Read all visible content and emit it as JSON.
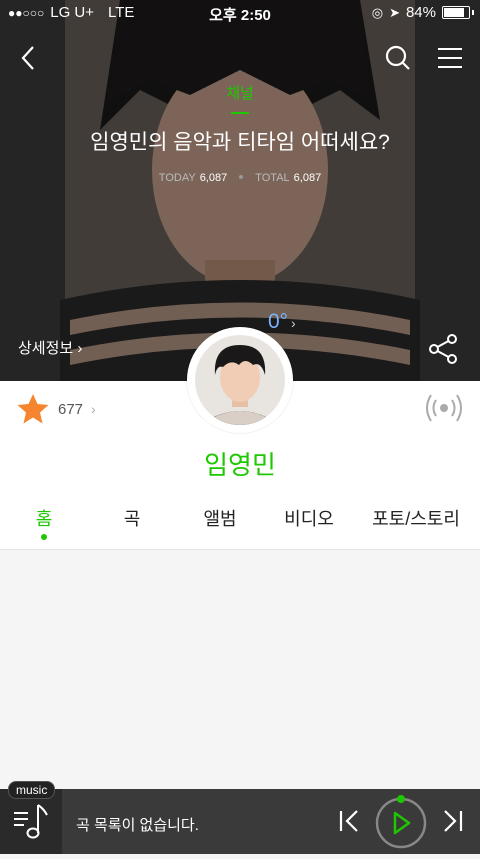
{
  "status_bar": {
    "carrier": "LG U+",
    "network": "LTE",
    "time": "오후 2:50",
    "battery": "84%",
    "battery_level": 0.84
  },
  "header": {
    "channel_label": "채널",
    "title": "임영민의 음악과 티타임 어떠세요?",
    "today_label": "TODAY",
    "today_count": "6,087",
    "total_label": "TOTAL",
    "total_count": "6,087",
    "degree": "0°",
    "details_label": "상세정보"
  },
  "profile": {
    "fan_count": "677",
    "artist_name": "임영민"
  },
  "tabs": [
    {
      "label": "홈",
      "active": true
    },
    {
      "label": "곡",
      "active": false
    },
    {
      "label": "앨범",
      "active": false
    },
    {
      "label": "비디오",
      "active": false
    },
    {
      "label": "포토/스토리",
      "active": false
    }
  ],
  "player": {
    "tag": "music",
    "empty_message": "곡 목록이 없습니다."
  },
  "colors": {
    "accent": "#1ec800",
    "star": "#f5852e",
    "degree": "#7ab3ff"
  },
  "icons": [
    "back-icon",
    "search-icon",
    "menu-icon",
    "share-icon",
    "star-icon",
    "broadcast-icon",
    "playlist-icon",
    "prev-icon",
    "play-icon",
    "next-icon"
  ]
}
